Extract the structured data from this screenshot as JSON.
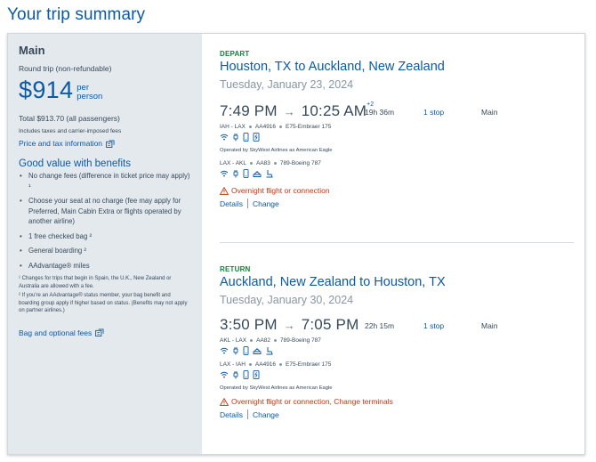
{
  "page": {
    "title": "Your trip summary"
  },
  "fare": {
    "name": "Main",
    "subtitle": "Round trip (non-refundable)",
    "price": "$914",
    "per_line1": "per",
    "per_line2": "person",
    "total": "Total $913.70 (all passengers)",
    "includes": "Includes taxes and carrier-imposed fees",
    "price_info_link": "Price and tax information",
    "benefits_title": "Good value with benefits",
    "benefits": [
      "No change fees (difference in ticket price may apply) ¹",
      "Choose your seat at no charge (fee may apply for Preferred, Main Cabin Extra or flights operated by another airline)",
      "1 free checked bag ²",
      "General boarding ²",
      "AAdvantage® miles"
    ],
    "footnote1": "¹ Changes for trips that begin in Spain, the U.K., New Zealand or Australia are allowed with a fee.",
    "footnote2": "² If you're an AAdvantage® status member, your bag benefit and boarding group apply if higher based on status. (Benefits may not apply on partner airlines.)",
    "bag_link": "Bag and optional fees"
  },
  "depart": {
    "label": "DEPART",
    "route": "Houston, TX to Auckland, New Zealand",
    "date": "Tuesday, January 23, 2024",
    "dep_time": "7:49 PM",
    "arr_time": "10:25 AM",
    "day_offset": "+2",
    "duration": "19h 36m",
    "stops": "1 stop",
    "cabin": "Main",
    "seg1": {
      "route": "IAH - LAX",
      "flight": "AA4916",
      "aircraft": "E75-Embraer 175"
    },
    "operated": "Operated by SkyWest Airlines as American Eagle",
    "seg2": {
      "route": "LAX - AKL",
      "flight": "AA83",
      "aircraft": "789-Boeing 787"
    },
    "warning": "Overnight flight or connection",
    "details": "Details",
    "change": "Change"
  },
  "return": {
    "label": "RETURN",
    "route": "Auckland, New Zealand to Houston, TX",
    "date": "Tuesday, January 30, 2024",
    "dep_time": "3:50 PM",
    "arr_time": "7:05 PM",
    "duration": "22h 15m",
    "stops": "1 stop",
    "cabin": "Main",
    "seg1": {
      "route": "AKL - LAX",
      "flight": "AA82",
      "aircraft": "789-Boeing 787"
    },
    "seg2": {
      "route": "LAX - IAH",
      "flight": "AA4916",
      "aircraft": "E75-Embraer 175"
    },
    "operated": "Operated by SkyWest Airlines as American Eagle",
    "warning": "Overnight flight or connection, Change terminals",
    "details": "Details",
    "change": "Change"
  },
  "colors": {
    "brand_blue": "#0b5aa6",
    "depart_green": "#16813a",
    "warning_red": "#c4360f",
    "fare_panel_bg": "#e4e9ee"
  }
}
